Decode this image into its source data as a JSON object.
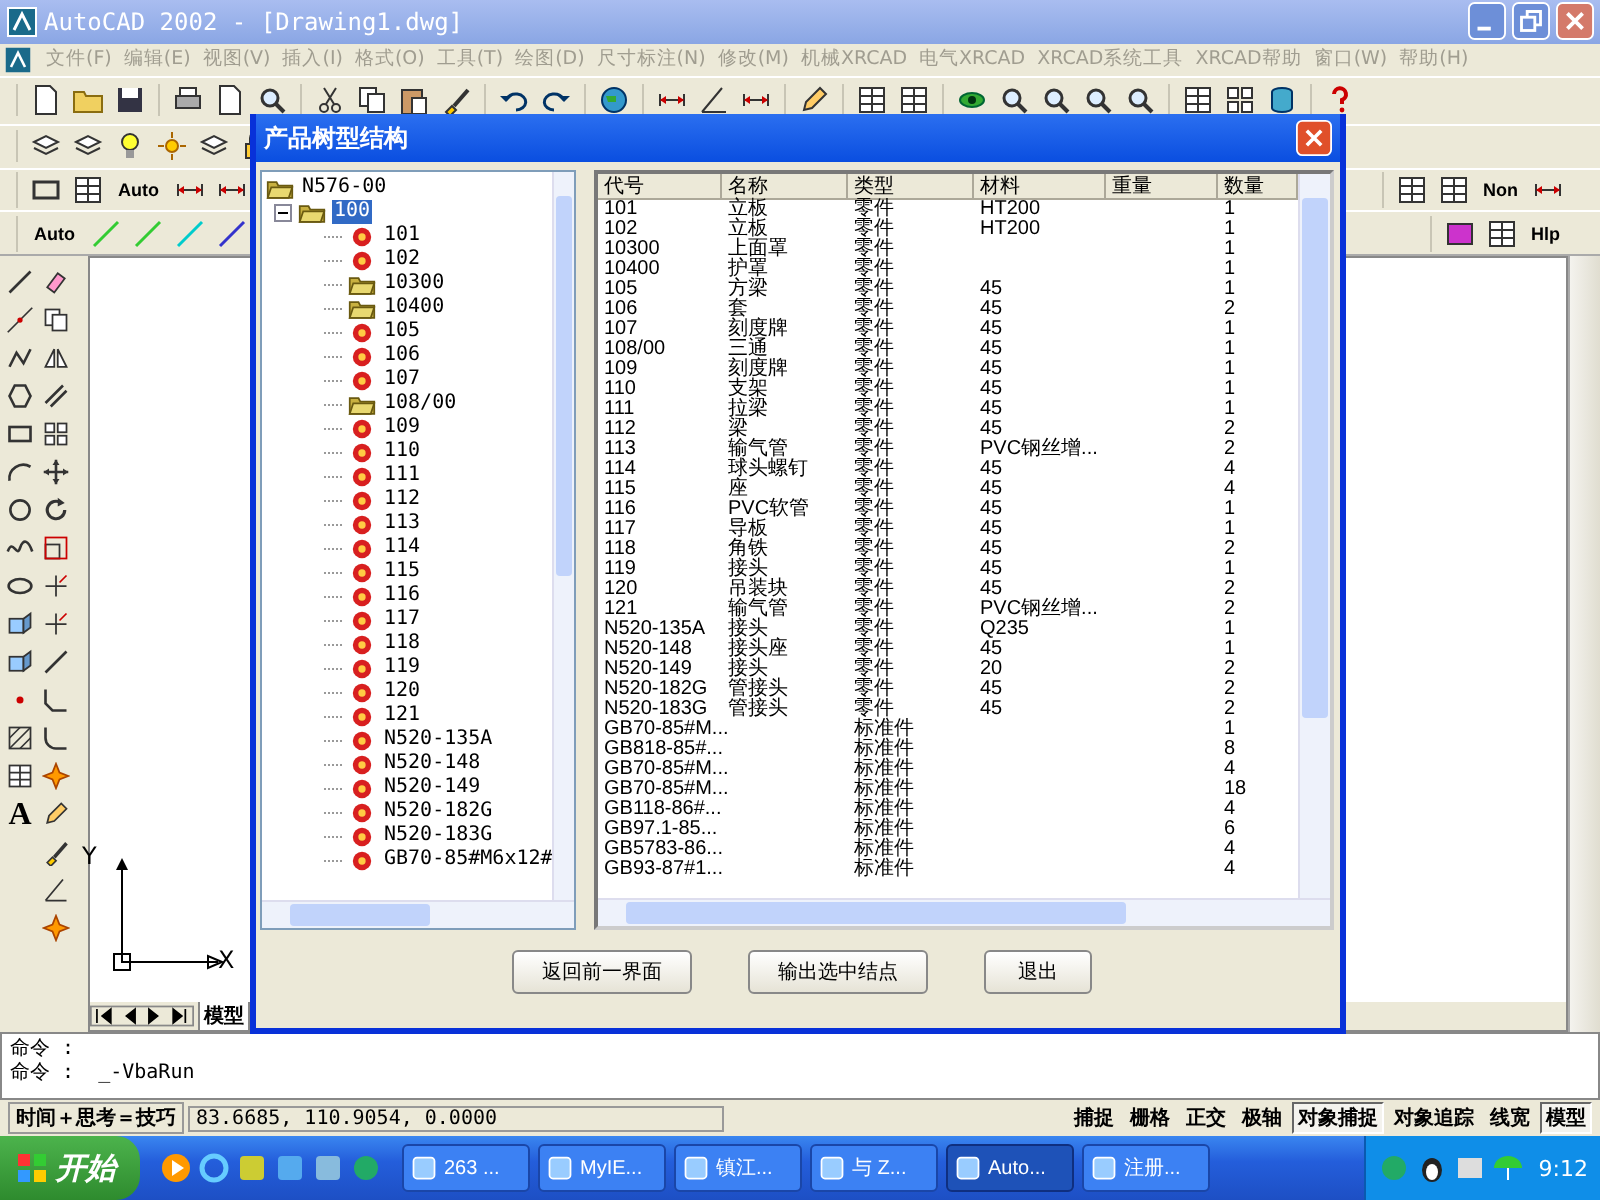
{
  "window": {
    "title": "AutoCAD 2002 - [Drawing1.dwg]"
  },
  "menu": [
    {
      "label": "文件(F)",
      "disabled": true
    },
    {
      "label": "编辑(E)",
      "disabled": true
    },
    {
      "label": "视图(V)",
      "disabled": true
    },
    {
      "label": "插入(I)",
      "disabled": true
    },
    {
      "label": "格式(O)",
      "disabled": true
    },
    {
      "label": "工具(T)",
      "disabled": true
    },
    {
      "label": "绘图(D)",
      "disabled": true
    },
    {
      "label": "尺寸标注(N)",
      "disabled": true
    },
    {
      "label": "修改(M)",
      "disabled": true
    },
    {
      "label": "机械XRCAD",
      "disabled": true
    },
    {
      "label": "电气XRCAD",
      "disabled": true
    },
    {
      "label": "XRCAD系统工具",
      "disabled": true
    },
    {
      "label": "XRCAD帮助",
      "disabled": true
    },
    {
      "label": "窗口(W)",
      "disabled": true
    },
    {
      "label": "帮助(H)",
      "disabled": true
    }
  ],
  "toolbars": {
    "row3_button": "Auto",
    "row4_button": "Auto",
    "row3_right_button": "Non",
    "row4_right_button": "Hlp"
  },
  "left_toolbar": {
    "text_tool": "A"
  },
  "drawing": {
    "ucs_y": "Y",
    "ucs_x": "X",
    "layout_tab": "模型"
  },
  "dialog": {
    "title": "产品树型结构",
    "tree": [
      {
        "label": "N576-00",
        "kind": "folder",
        "expanded": true,
        "selected": false,
        "children": [
          {
            "label": "100",
            "kind": "folder",
            "expanded": true,
            "selected": true,
            "children": [
              {
                "label": "101",
                "kind": "part",
                "selected": false
              },
              {
                "label": "102",
                "kind": "part",
                "selected": false
              },
              {
                "label": "10300",
                "kind": "folder",
                "selected": false
              },
              {
                "label": "10400",
                "kind": "folder",
                "selected": false
              },
              {
                "label": "105",
                "kind": "part",
                "selected": false
              },
              {
                "label": "106",
                "kind": "part",
                "selected": false
              },
              {
                "label": "107",
                "kind": "part",
                "selected": false
              },
              {
                "label": "108/00",
                "kind": "folder",
                "selected": false
              },
              {
                "label": "109",
                "kind": "part",
                "selected": false
              },
              {
                "label": "110",
                "kind": "part",
                "selected": false
              },
              {
                "label": "111",
                "kind": "part",
                "selected": false
              },
              {
                "label": "112",
                "kind": "part",
                "selected": false
              },
              {
                "label": "113",
                "kind": "part",
                "selected": false
              },
              {
                "label": "114",
                "kind": "part",
                "selected": false
              },
              {
                "label": "115",
                "kind": "part",
                "selected": false
              },
              {
                "label": "116",
                "kind": "part",
                "selected": false
              },
              {
                "label": "117",
                "kind": "part",
                "selected": false
              },
              {
                "label": "118",
                "kind": "part",
                "selected": false
              },
              {
                "label": "119",
                "kind": "part",
                "selected": false
              },
              {
                "label": "120",
                "kind": "part",
                "selected": false
              },
              {
                "label": "121",
                "kind": "part",
                "selected": false
              },
              {
                "label": "N520-135A",
                "kind": "part",
                "selected": false
              },
              {
                "label": "N520-148",
                "kind": "part",
                "selected": false
              },
              {
                "label": "N520-149",
                "kind": "part",
                "selected": false
              },
              {
                "label": "N520-182G",
                "kind": "part",
                "selected": false
              },
              {
                "label": "N520-183G",
                "kind": "part",
                "selected": false
              },
              {
                "label": "GB70-85#M6x12#",
                "kind": "part",
                "selected": false
              }
            ]
          }
        ]
      }
    ],
    "table": {
      "columns": [
        "代号",
        "名称",
        "类型",
        "材料",
        "重量",
        "数量"
      ],
      "rows": [
        {
          "code": "101",
          "name": "立板",
          "type": "零件",
          "material": "HT200",
          "quantity": "1"
        },
        {
          "code": "102",
          "name": "立板",
          "type": "零件",
          "material": "HT200",
          "quantity": "1"
        },
        {
          "code": "10300",
          "name": "上面罩",
          "type": "零件",
          "quantity": "1"
        },
        {
          "code": "10400",
          "name": "护罩",
          "type": "零件",
          "quantity": "1"
        },
        {
          "code": "105",
          "name": "方梁",
          "type": "零件",
          "material": "45",
          "quantity": "1"
        },
        {
          "code": "106",
          "name": "套",
          "type": "零件",
          "material": "45",
          "quantity": "2"
        },
        {
          "code": "107",
          "name": "刻度牌",
          "type": "零件",
          "material": "45",
          "quantity": "1"
        },
        {
          "code": "108/00",
          "name": "三通",
          "type": "零件",
          "material": "45",
          "quantity": "1"
        },
        {
          "code": "109",
          "name": "刻度牌",
          "type": "零件",
          "material": "45",
          "quantity": "1"
        },
        {
          "code": "110",
          "name": "支架",
          "type": "零件",
          "material": "45",
          "quantity": "1"
        },
        {
          "code": "111",
          "name": "拉梁",
          "type": "零件",
          "material": "45",
          "quantity": "1"
        },
        {
          "code": "112",
          "name": "梁",
          "type": "零件",
          "material": "45",
          "quantity": "2"
        },
        {
          "code": "113",
          "name": "输气管",
          "type": "零件",
          "material": "PVC钢丝增...",
          "quantity": "2"
        },
        {
          "code": "114",
          "name": "球头螺钉",
          "type": "零件",
          "material": "45",
          "quantity": "4"
        },
        {
          "code": "115",
          "name": "座",
          "type": "零件",
          "material": "45",
          "quantity": "4"
        },
        {
          "code": "116",
          "name": "PVC软管",
          "type": "零件",
          "material": "45",
          "quantity": "1"
        },
        {
          "code": "117",
          "name": "导板",
          "type": "零件",
          "material": "45",
          "quantity": "1"
        },
        {
          "code": "118",
          "name": "角铁",
          "type": "零件",
          "material": "45",
          "quantity": "2"
        },
        {
          "code": "119",
          "name": "接头",
          "type": "零件",
          "material": "45",
          "quantity": "1"
        },
        {
          "code": "120",
          "name": "吊装块",
          "type": "零件",
          "material": "45",
          "quantity": "2"
        },
        {
          "code": "121",
          "name": "输气管",
          "type": "零件",
          "material": "PVC钢丝增...",
          "quantity": "2"
        },
        {
          "code": "N520-135A",
          "name": "接头",
          "type": "零件",
          "material": "Q235",
          "quantity": "1"
        },
        {
          "code": "N520-148",
          "name": "接头座",
          "type": "零件",
          "material": "45",
          "quantity": "1"
        },
        {
          "code": "N520-149",
          "name": "接头",
          "type": "零件",
          "material": "20",
          "quantity": "2"
        },
        {
          "code": "N520-182G",
          "name": "管接头",
          "type": "零件",
          "material": "45",
          "quantity": "2"
        },
        {
          "code": "N520-183G",
          "name": "管接头",
          "type": "零件",
          "material": "45",
          "quantity": "2"
        },
        {
          "code": "GB70-85#M...",
          "type": "标准件",
          "quantity": "1"
        },
        {
          "code": "GB818-85#...",
          "type": "标准件",
          "quantity": "8"
        },
        {
          "code": "GB70-85#M...",
          "type": "标准件",
          "quantity": "4"
        },
        {
          "code": "GB70-85#M...",
          "type": "标准件",
          "quantity": "18"
        },
        {
          "code": "GB118-86#...",
          "type": "标准件",
          "quantity": "4"
        },
        {
          "code": "GB97.1-85...",
          "type": "标准件",
          "quantity": "6"
        },
        {
          "code": "GB5783-86...",
          "type": "标准件",
          "quantity": "4"
        },
        {
          "code": "GB93-87#1...",
          "type": "标准件",
          "quantity": "4"
        }
      ]
    },
    "buttons": [
      "返回前一界面",
      "输出选中结点",
      "退出"
    ]
  },
  "command_lines": [
    "命令 :",
    "命令 :  _-VbaRun"
  ],
  "status_bar": {
    "tip": "时间＋思考＝技巧",
    "coordinates": "83.6685, 110.9054, 0.0000",
    "toggles": [
      {
        "label": "捕捉",
        "on": false
      },
      {
        "label": "栅格",
        "on": false
      },
      {
        "label": "正交",
        "on": false
      },
      {
        "label": "极轴",
        "on": false
      },
      {
        "label": "对象捕捉",
        "on": true
      },
      {
        "label": "对象追踪",
        "on": false
      },
      {
        "label": "线宽",
        "on": false
      },
      {
        "label": "模型",
        "on": true
      }
    ]
  },
  "taskbar": {
    "start": "开始",
    "tasks": [
      {
        "label": "263 ...",
        "selected": false
      },
      {
        "label": "MyIE...",
        "selected": false
      },
      {
        "label": "镇江...",
        "selected": false
      },
      {
        "label": "与 Z...",
        "selected": false
      },
      {
        "label": "Auto...",
        "selected": true
      },
      {
        "label": "注册...",
        "selected": false
      }
    ],
    "clock": "9:12"
  }
}
